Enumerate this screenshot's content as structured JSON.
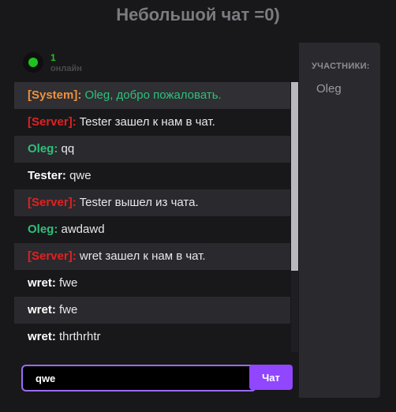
{
  "page": {
    "title": "Небольшой чат =0)"
  },
  "header": {
    "online_count": "1",
    "online_label": "онлайн"
  },
  "messages": [
    {
      "author": "[System]:",
      "text": " Oleg, добро пожаловать.",
      "author_color": "#f0913a",
      "text_color": "#2fc07a"
    },
    {
      "author": "[Server]:",
      "text": " Tester зашел к нам в чат.",
      "author_color": "#e32020",
      "text_color": "#e8e8ea"
    },
    {
      "author": "Oleg:",
      "text": " qq",
      "author_color": "#2fc07a",
      "text_color": "#e8e8ea"
    },
    {
      "author": "Tester:",
      "text": " qwe",
      "author_color": "#ffffff",
      "text_color": "#e8e8ea"
    },
    {
      "author": "[Server]:",
      "text": " Tester вышел из чата.",
      "author_color": "#e32020",
      "text_color": "#e8e8ea"
    },
    {
      "author": "Oleg:",
      "text": " awdawd",
      "author_color": "#2fc07a",
      "text_color": "#e8e8ea"
    },
    {
      "author": "[Server]:",
      "text": " wret зашел к нам в чат.",
      "author_color": "#e32020",
      "text_color": "#e8e8ea"
    },
    {
      "author": "wret:",
      "text": " fwe",
      "author_color": "#ffffff",
      "text_color": "#e8e8ea"
    },
    {
      "author": "wret:",
      "text": " fwe",
      "author_color": "#ffffff",
      "text_color": "#e8e8ea"
    },
    {
      "author": "wret:",
      "text": " thrthrhtr",
      "author_color": "#ffffff",
      "text_color": "#e8e8ea"
    }
  ],
  "input": {
    "value": "qwe"
  },
  "send_button": {
    "label": "Чат"
  },
  "sidebar": {
    "title": "УЧАСТНИКИ:",
    "participants": [
      "Oleg"
    ]
  },
  "colors": {
    "accent": "#9146ff",
    "online": "#1ec41e"
  }
}
